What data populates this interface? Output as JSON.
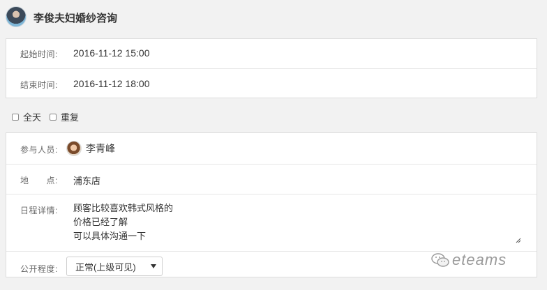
{
  "header": {
    "title": "李俊夫妇婚纱咨询",
    "avatar_icon": "user-avatar"
  },
  "time": {
    "start_label": "起始时间:",
    "start_value": "2016-11-12 15:00",
    "end_label": "结束时间:",
    "end_value": "2016-11-12 18:00"
  },
  "toggles": {
    "all_day_label": "全天",
    "all_day_checked": false,
    "repeat_label": "重复",
    "repeat_checked": false
  },
  "details": {
    "participants_label": "参与人员:",
    "participant_name": "李青峰",
    "location_label": "地　　点:",
    "location_value": "浦东店",
    "schedule_label": "日程详情:",
    "schedule_text": "顾客比较喜欢韩式风格的\n价格已经了解\n可以具体沟通一下",
    "visibility_label": "公开程度:",
    "visibility_value": "正常(上级可见)"
  },
  "watermark": {
    "text": "eteams",
    "icon": "wechat-icon"
  }
}
